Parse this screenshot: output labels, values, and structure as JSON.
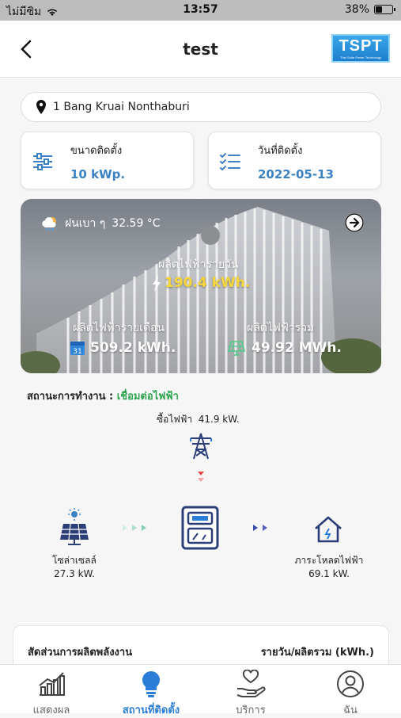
{
  "status_bar": {
    "carrier": "ไม่มีซิม",
    "time": "13:57",
    "battery": "38%"
  },
  "header": {
    "title": "test",
    "logo_text": "TSPT",
    "logo_sub": "Thai Solar Power Technology"
  },
  "address": "1  Bang Kruai  Nonthaburi",
  "install_capacity": {
    "label": "ขนาดติดตั้ง",
    "value": "10 kWp."
  },
  "install_date": {
    "label": "วันที่ติดตั้ง",
    "value": "2022-05-13"
  },
  "hero": {
    "weather": "ฝนเบา ๆ",
    "temperature": "32.59 °C",
    "daily_label": "ผลิตไฟฟ้ารายวัน",
    "daily_value": "190.4 kWh.",
    "monthly_label": "ผลิตไฟฟ้ารายเดือน",
    "monthly_value": "509.2 kWh.",
    "total_label": "ผลิตไฟฟ้ารวม",
    "total_value": "49.92 MWh."
  },
  "operation": {
    "label": "สถานะการทำงาน :",
    "value": "เชื่อมต่อไฟฟ้า"
  },
  "flow": {
    "grid_label": "ซื้อไฟฟ้า",
    "grid_value": "41.9 kW.",
    "solar_label": "โซล่าเซลล์",
    "solar_value": "27.3 kW.",
    "load_label": "ภาระโหลดไฟฟ้า",
    "load_value": "69.1 kW."
  },
  "summary": {
    "left": "สัดส่วนการผลิตพลังงาน",
    "right": "รายวัน/ผลิตรวม (kWh.)"
  },
  "tabs": [
    {
      "label": "แสดงผล",
      "icon": "chart-icon"
    },
    {
      "label": "สถานที่ติดตั้ง",
      "icon": "lightbulb-icon"
    },
    {
      "label": "บริการ",
      "icon": "hand-heart-icon"
    },
    {
      "label": "ฉัน",
      "icon": "user-icon"
    }
  ],
  "colors": {
    "accent": "#2b7ed8",
    "value_blue": "#3b82c4",
    "ok_green": "#2ea44f",
    "daily_yellow": "#f5d63a"
  }
}
